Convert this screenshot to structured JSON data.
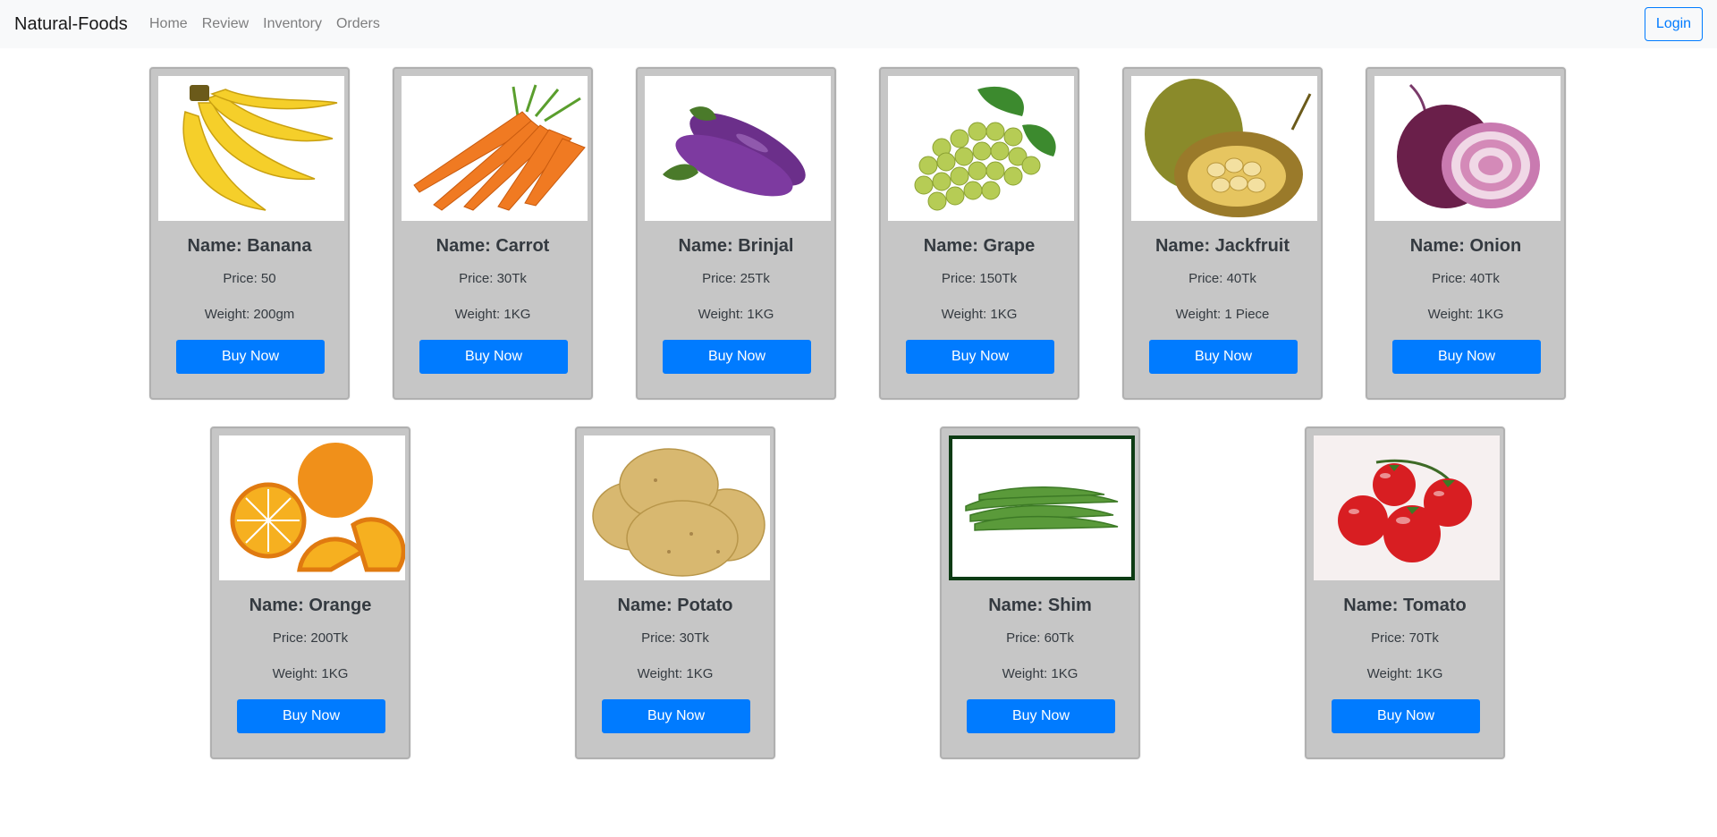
{
  "navbar": {
    "brand": "Natural-Foods",
    "links": [
      "Home",
      "Review",
      "Inventory",
      "Orders"
    ],
    "login_label": "Login"
  },
  "colors": {
    "navbar_bg": "#f8f9fa",
    "card_bg": "#c6c6c6",
    "primary": "#007bff"
  },
  "products": [
    {
      "name": "Name: Banana",
      "price": "Price: 50",
      "weight": "Weight: 200gm",
      "button": "Buy Now",
      "image_icon": "banana-image"
    },
    {
      "name": "Name: Carrot",
      "price": "Price: 30Tk",
      "weight": "Weight: 1KG",
      "button": "Buy Now",
      "image_icon": "carrot-image"
    },
    {
      "name": "Name: Brinjal",
      "price": "Price: 25Tk",
      "weight": "Weight: 1KG",
      "button": "Buy Now",
      "image_icon": "brinjal-image"
    },
    {
      "name": "Name: Grape",
      "price": "Price: 150Tk",
      "weight": "Weight: 1KG",
      "button": "Buy Now",
      "image_icon": "grape-image"
    },
    {
      "name": "Name: Jackfruit",
      "price": "Price: 40Tk",
      "weight": "Weight: 1 Piece",
      "button": "Buy Now",
      "image_icon": "jackfruit-image"
    },
    {
      "name": "Name: Onion",
      "price": "Price: 40Tk",
      "weight": "Weight: 1KG",
      "button": "Buy Now",
      "image_icon": "onion-image"
    },
    {
      "name": "Name: Orange",
      "price": "Price: 200Tk",
      "weight": "Weight: 1KG",
      "button": "Buy Now",
      "image_icon": "orange-image"
    },
    {
      "name": "Name: Potato",
      "price": "Price: 30Tk",
      "weight": "Weight: 1KG",
      "button": "Buy Now",
      "image_icon": "potato-image"
    },
    {
      "name": "Name: Shim",
      "price": "Price: 60Tk",
      "weight": "Weight: 1KG",
      "button": "Buy Now",
      "image_icon": "beans-image"
    },
    {
      "name": "Name: Tomato",
      "price": "Price: 70Tk",
      "weight": "Weight: 1KG",
      "button": "Buy Now",
      "image_icon": "tomato-image"
    }
  ]
}
